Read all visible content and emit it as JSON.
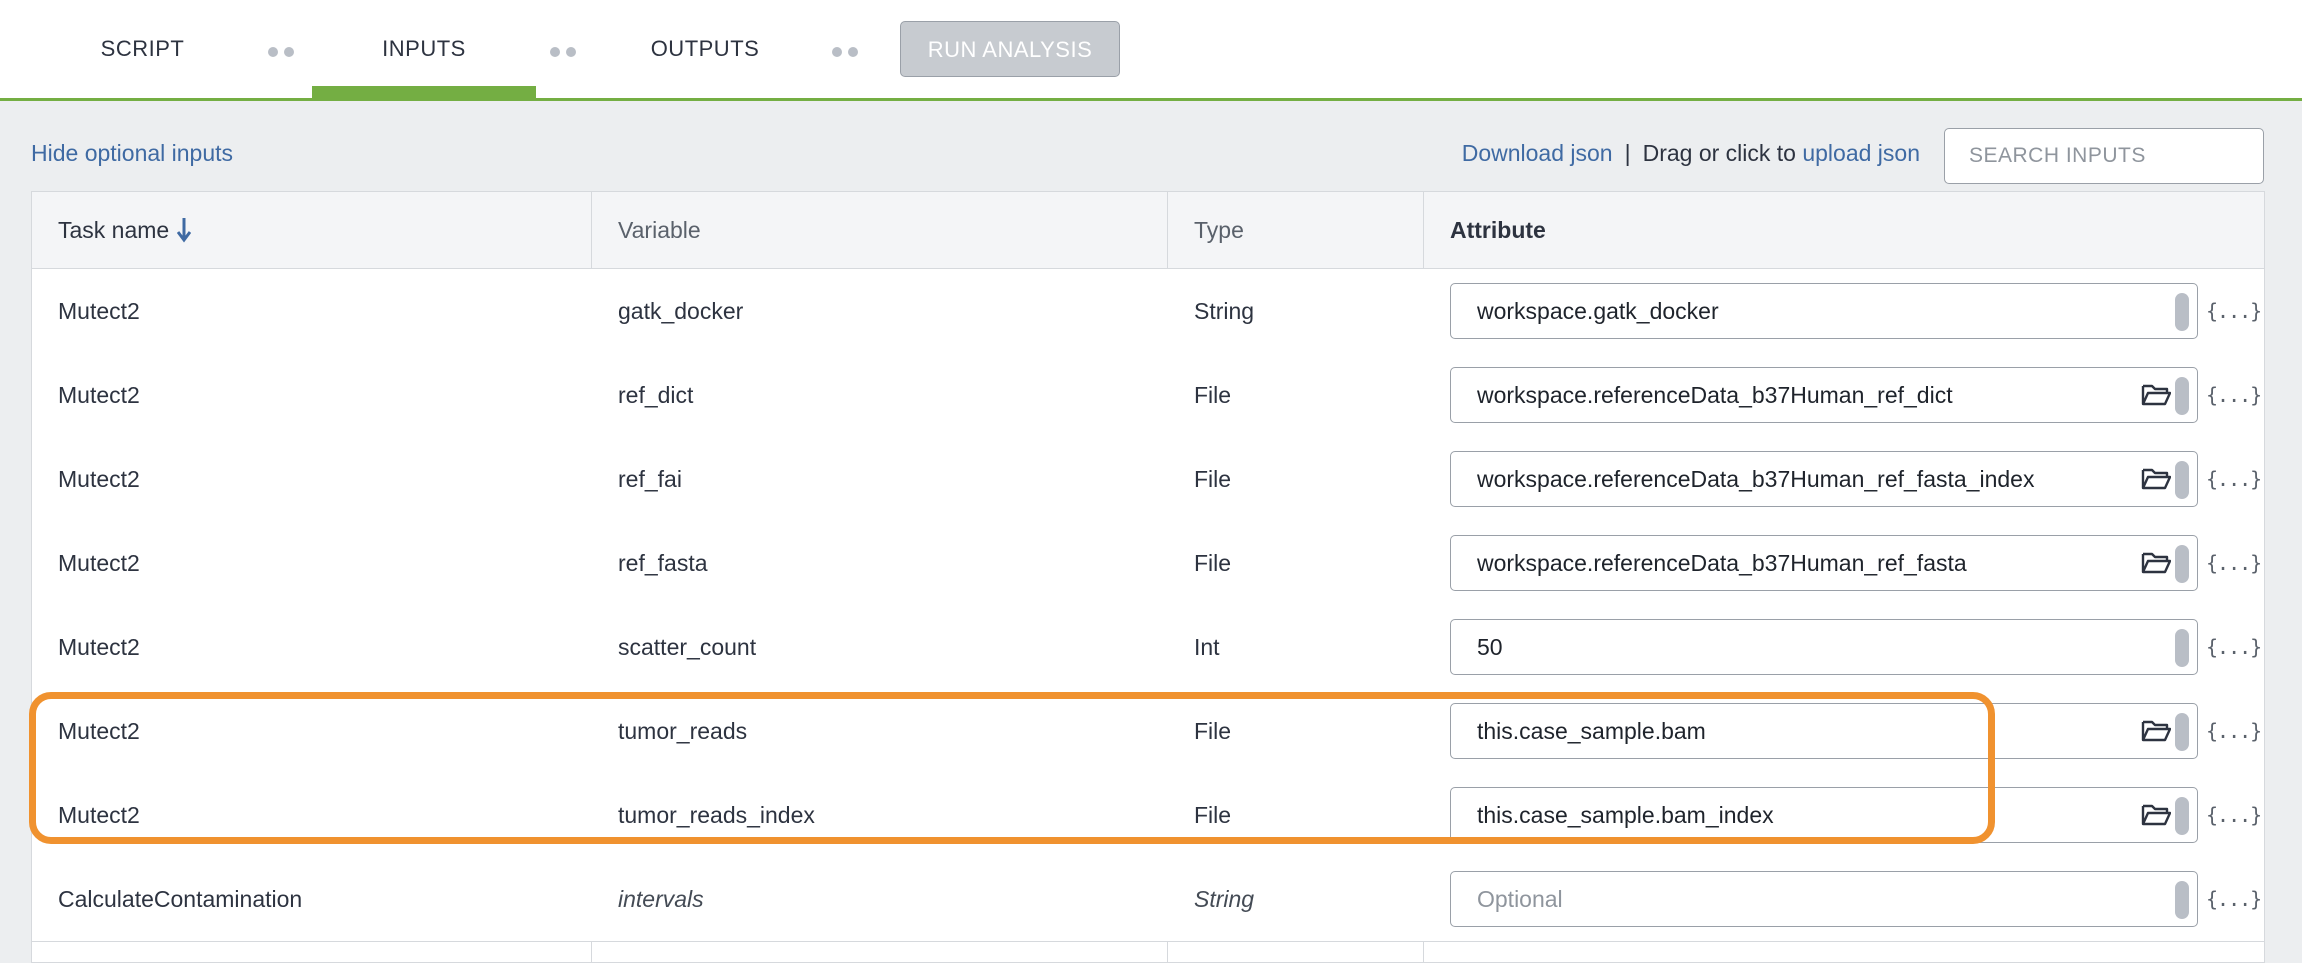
{
  "tabs": {
    "script": "SCRIPT",
    "inputs": "INPUTS",
    "outputs": "OUTPUTS",
    "run_analysis": "RUN ANALYSIS",
    "active": "INPUTS"
  },
  "toolbar": {
    "hide_optional": "Hide optional inputs",
    "download_json": "Download json",
    "separator": "|",
    "drag_text": "Drag or click to",
    "upload_json": "upload json",
    "search_placeholder": "SEARCH INPUTS"
  },
  "table": {
    "headers": {
      "task_name": "Task name",
      "variable": "Variable",
      "type": "Type",
      "attribute": "Attribute"
    },
    "sort": "task_name ascending",
    "expression_label": "{...}",
    "rows": [
      {
        "task": "Mutect2",
        "variable": "gatk_docker",
        "type": "String",
        "attribute": "workspace.gatk_docker",
        "file_browser": false,
        "optional": false
      },
      {
        "task": "Mutect2",
        "variable": "ref_dict",
        "type": "File",
        "attribute": "workspace.referenceData_b37Human_ref_dict",
        "file_browser": true,
        "optional": false
      },
      {
        "task": "Mutect2",
        "variable": "ref_fai",
        "type": "File",
        "attribute": "workspace.referenceData_b37Human_ref_fasta_index",
        "file_browser": true,
        "optional": false
      },
      {
        "task": "Mutect2",
        "variable": "ref_fasta",
        "type": "File",
        "attribute": "workspace.referenceData_b37Human_ref_fasta",
        "file_browser": true,
        "optional": false
      },
      {
        "task": "Mutect2",
        "variable": "scatter_count",
        "type": "Int",
        "attribute": "50",
        "file_browser": false,
        "optional": false
      },
      {
        "task": "Mutect2",
        "variable": "tumor_reads",
        "type": "File",
        "attribute": "this.case_sample.bam",
        "file_browser": true,
        "optional": false
      },
      {
        "task": "Mutect2",
        "variable": "tumor_reads_index",
        "type": "File",
        "attribute": "this.case_sample.bam_index",
        "file_browser": true,
        "optional": false
      },
      {
        "task": "CalculateContamination",
        "variable": "intervals",
        "type": "String",
        "attribute_placeholder": "Optional",
        "file_browser": false,
        "optional": true
      }
    ]
  },
  "colors": {
    "accent_green": "#74ae43",
    "link_blue": "#3f6aa3",
    "highlight_orange": "#f0922f"
  }
}
